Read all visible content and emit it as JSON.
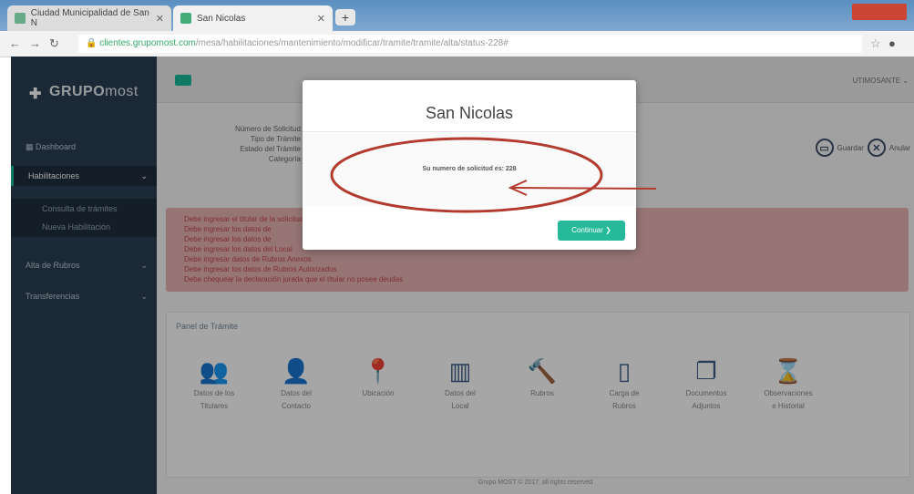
{
  "browser": {
    "tab1_title": "Ciudad Municipalidad de San N",
    "tab2_title": "San Nicolas",
    "url_secure": "clientes.grupomost.com",
    "url_rest": "/mesa/habilitaciones/mantenimiento/modificar/tramite/tramite/alta/status-228#",
    "new_tab": "+"
  },
  "sidebar": {
    "logo_bold": "GRUPO",
    "logo_light": "most",
    "items": [
      {
        "label": "Dashboard"
      },
      {
        "label": "Habilitaciones"
      },
      {
        "label": "Consulta de trámites"
      },
      {
        "label": "Nueva Habilitación"
      },
      {
        "label": "Alta de Rubros"
      },
      {
        "label": "Transferencias"
      }
    ]
  },
  "topbar": {
    "user": "UTIMOSANTE"
  },
  "form": {
    "labels": [
      "Número de Solicitud",
      "Tipo de Trámite",
      "Estado del Trámite",
      "Categoría"
    ]
  },
  "actions": {
    "save_label": "Guardar",
    "cancel_label": "Anular"
  },
  "alert": {
    "lines": [
      "Debe ingresar el titular de la solicitud",
      "Debe ingresar los datos de",
      "Debe ingresar los datos de",
      "Debe ingresar los datos del Local",
      "Debe ingresar datos de Rubros Anexos",
      "Debe ingresar los datos de Rubros Autorizados",
      "Debe chequear la declaración jurada que el titular no posee deudas"
    ]
  },
  "panel": {
    "title": "Panel de Trámite",
    "tiles": [
      {
        "icon": "users-icon",
        "line1": "Datos de los",
        "line2": "Titulares"
      },
      {
        "icon": "user-plus-icon",
        "line1": "Datos del",
        "line2": "Contacto"
      },
      {
        "icon": "map-marker-icon",
        "line1": "Ubicación",
        "line2": ""
      },
      {
        "icon": "map-icon",
        "line1": "Datos del",
        "line2": "Local"
      },
      {
        "icon": "gavel-icon",
        "line1": "Rubros",
        "line2": ""
      },
      {
        "icon": "folded-map-icon",
        "line1": "Carga de",
        "line2": "Rubros"
      },
      {
        "icon": "copy-icon",
        "line1": "Documentos",
        "line2": "Adjuntos"
      },
      {
        "icon": "hourglass-icon",
        "line1": "Observaciones",
        "line2": "e Historial"
      }
    ]
  },
  "footer": "Grupo MOST © 2017, all rights reserved",
  "modal": {
    "title": "San Nicolas",
    "message": "Su numero de solicitud es: 228",
    "continue_label": "Continuar ❯"
  },
  "colors": {
    "accent": "#26b99a",
    "sidebar": "#2a3f54",
    "annotation": "#b23a2e"
  }
}
